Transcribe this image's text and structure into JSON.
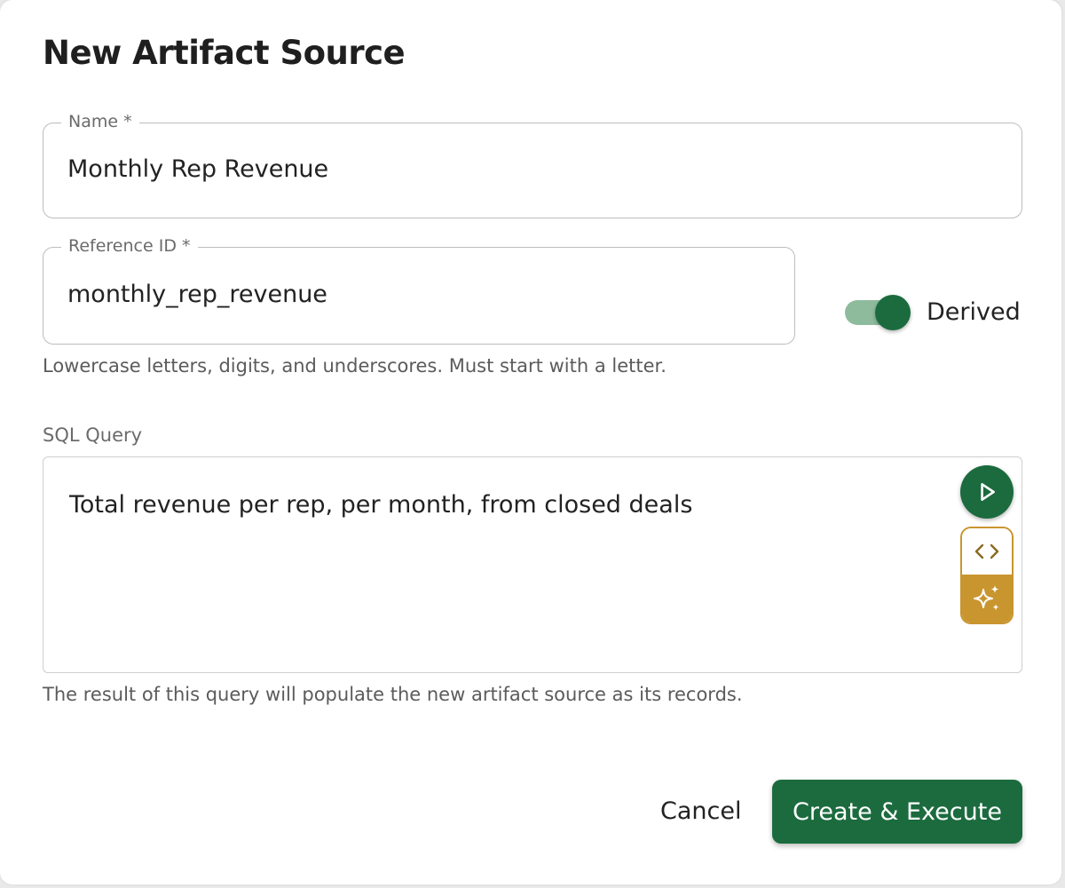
{
  "dialog": {
    "title": "New Artifact Source"
  },
  "name_field": {
    "label": "Name *",
    "value": "Monthly Rep Revenue"
  },
  "reference_field": {
    "label": "Reference ID *",
    "value": "monthly_rep_revenue",
    "helper": "Lowercase letters, digits, and underscores. Must start with a letter."
  },
  "derived_toggle": {
    "label": "Derived",
    "checked": true
  },
  "sql": {
    "label": "SQL Query",
    "value": "Total revenue per rep, per month, from closed deals",
    "helper": "The result of this query will populate the new artifact source as its records.",
    "run_icon": "play-icon",
    "code_icon": "code-icon",
    "ai_icon": "sparkles-icon"
  },
  "actions": {
    "cancel_label": "Cancel",
    "submit_label": "Create & Execute"
  },
  "colors": {
    "primary": "#1b6b3e",
    "toggle_track": "#8fbb9d",
    "ai_accent": "#c9952f"
  }
}
